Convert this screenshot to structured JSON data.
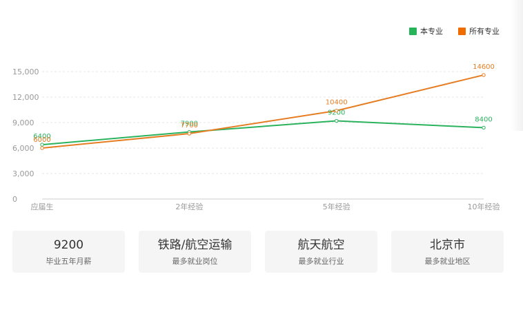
{
  "legend": {
    "major_label": "本专业",
    "all_label": "所有专业",
    "major_color": "#27b35a",
    "all_color": "#ef6c00"
  },
  "chart_data": {
    "type": "line",
    "categories": [
      "应届生",
      "2年经验",
      "5年经验",
      "10年经验"
    ],
    "series": [
      {
        "name": "本专业",
        "values": [
          6400,
          7900,
          9200,
          8400
        ],
        "color": "#2ab25d"
      },
      {
        "name": "所有专业",
        "values": [
          6000,
          7700,
          10400,
          14600
        ],
        "color": "#e67d22"
      }
    ],
    "ylim": [
      0,
      15000
    ],
    "yticks": [
      0,
      3000,
      6000,
      9000,
      12000,
      15000
    ],
    "ytick_labels": [
      "0",
      "3,000",
      "6,000",
      "9,000",
      "12,000",
      "15,000"
    ],
    "grid": true,
    "legend_position": "top-right"
  },
  "cards": [
    {
      "value": "9200",
      "label": "毕业五年月薪"
    },
    {
      "value": "铁路/航空运输",
      "label": "最多就业岗位"
    },
    {
      "value": "航天航空",
      "label": "最多就业行业"
    },
    {
      "value": "北京市",
      "label": "最多就业地区"
    }
  ]
}
